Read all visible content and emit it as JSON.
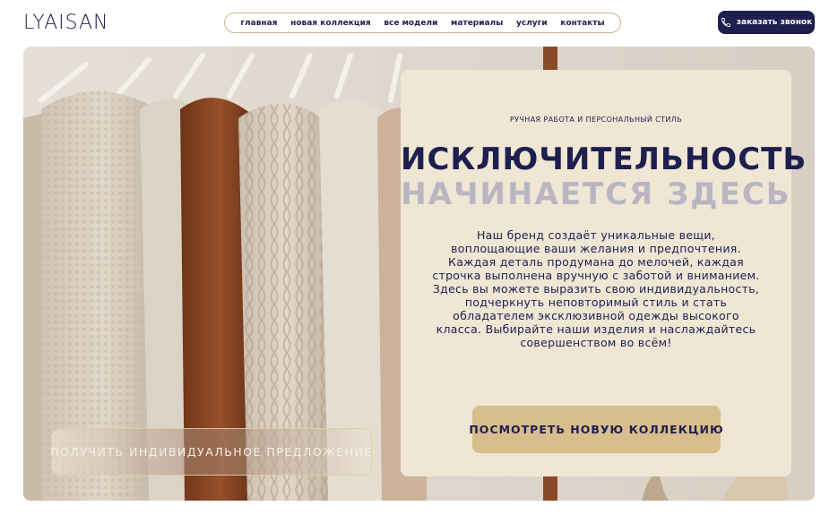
{
  "header": {
    "logo": "LYAISAN",
    "nav": [
      "главная",
      "новая коллекция",
      "все модели",
      "материалы",
      "услуги",
      "контакты"
    ],
    "call_button": "заказать звонок",
    "call_icon": "phone-icon"
  },
  "hero": {
    "offer_button": "получить индивидуальное предложение",
    "panel": {
      "tagline": "ручная работа и персональный стиль",
      "headline_line1": "исключительность",
      "headline_line2": "начинается здесь",
      "description": "Наш бренд создаёт уникальные вещи, воплощающие ваши желания и предпочтения. Каждая деталь продумана до мелочей, каждая строчка выполнена вручную с заботой и вниманием. Здесь вы можете выразить свою индивидуальность, подчеркнуть неповторимый стиль и стать обладателем эксклюзивной одежды высокого класса. Выбирайте наши изделия и наслаждайтесь совершенством во всём!",
      "collection_button": "посмотреть новую коллекцию"
    }
  },
  "colors": {
    "navy": "#1d1f4f",
    "panel": "#efe6d4",
    "gold_button": "#d8bd8d",
    "muted_headline": "#b9b6c2"
  }
}
